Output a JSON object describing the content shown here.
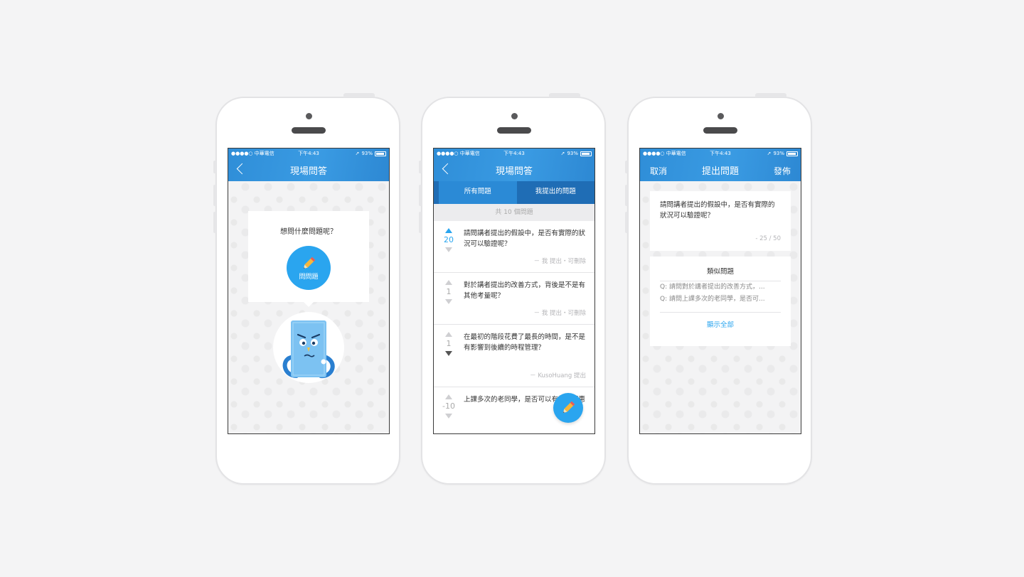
{
  "status": {
    "carrier": "●●●●○ 中華電信",
    "time": "下午4:43",
    "battery": "93%"
  },
  "screen1": {
    "title": "現場問答",
    "prompt": "想問什麼問題呢？",
    "ask_button": "問問題"
  },
  "screen2": {
    "title": "現場問答",
    "tabs": [
      {
        "label": "所有問題"
      },
      {
        "label": "我提出的問題"
      }
    ],
    "count_label": "共 10 個問題",
    "questions": [
      {
        "votes": "20",
        "text": "請問講者提出的假設中，是否有實際的狀況可以驗證呢？",
        "meta": "－ 我 提出・可刪除"
      },
      {
        "votes": "1",
        "text": "對於講者提出的改善方式，背後是不是有其他考量呢？",
        "meta": "－ 我 提出・可刪除"
      },
      {
        "votes": "1",
        "text": "在最初的階段花費了最長的時間，是不是有影響到後續的時程管理？",
        "meta": "－ KusoHuang 提出"
      },
      {
        "votes": "-10",
        "text": "上課多次的老同學，是否可以有折扣優惠",
        "meta": ""
      }
    ]
  },
  "screen3": {
    "cancel": "取消",
    "title": "提出問題",
    "publish": "發佈",
    "draft_text": "請問講者提出的假設中，是否有實際的狀況可以驗證呢？",
    "char_count": "- 25 / 50",
    "similar_title": "類似問題",
    "similar_items": [
      "Q:  請問對於講者提出的改善方式，...",
      "Q:  請問上課多次的老同學，是否可..."
    ],
    "show_all": "顯示全部"
  },
  "colors": {
    "primary": "#2aa5ef",
    "header": "#2f8ed8",
    "tab_bar": "#1f6db5"
  }
}
